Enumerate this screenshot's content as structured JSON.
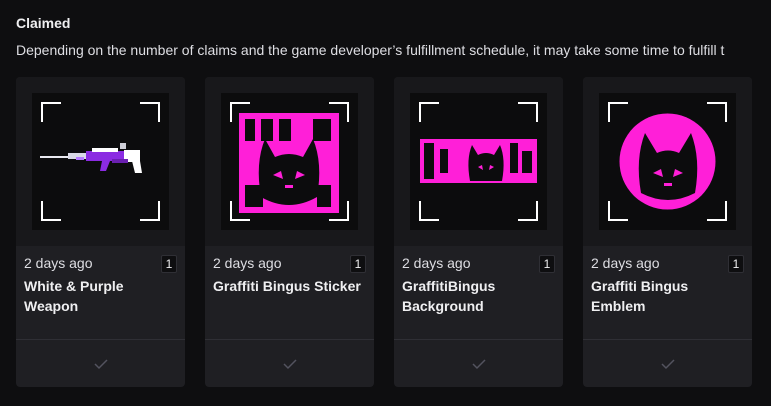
{
  "section": {
    "title": "Claimed",
    "description": "Depending on the number of claims and the game developer’s fulfillment schedule, it may take some time to fulfill t"
  },
  "cards": [
    {
      "time": "2 days ago",
      "quantity": "1",
      "name": "White & Purple Weapon",
      "icon": "weapon-art",
      "status_icon": "checkmark-icon"
    },
    {
      "time": "2 days ago",
      "quantity": "1",
      "name": "Graffiti Bingus Sticker",
      "icon": "sticker-art",
      "status_icon": "checkmark-icon"
    },
    {
      "time": "2 days ago",
      "quantity": "1",
      "name": "GraffitiBingus Background",
      "icon": "background-art",
      "status_icon": "checkmark-icon"
    },
    {
      "time": "2 days ago",
      "quantity": "1",
      "name": "Graffiti Bingus Emblem",
      "icon": "emblem-art",
      "status_icon": "checkmark-icon"
    }
  ],
  "colors": {
    "background": "#0e0e10",
    "card": "#1f1f23",
    "accent_pink": "#ff1fd8",
    "accent_purple": "#8b2be2"
  }
}
